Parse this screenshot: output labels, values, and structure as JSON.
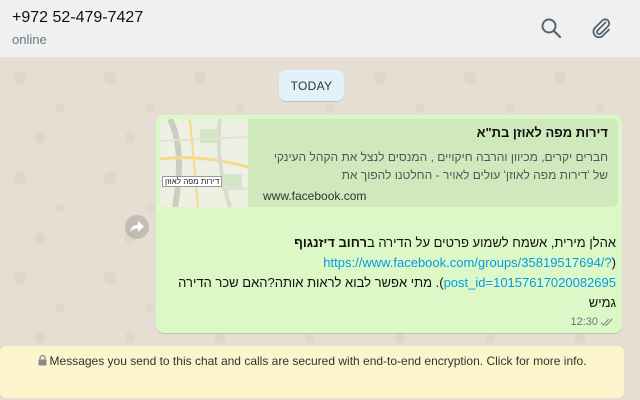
{
  "header": {
    "contact_name": "+972 52-479-7427",
    "status": "online",
    "icons": [
      "search-icon",
      "paperclip-icon"
    ]
  },
  "chat": {
    "day_label": "TODAY",
    "message": {
      "preview": {
        "title": "דירות מפה לאוזן בת\"א",
        "description": "חברים יקרים, מכיוון והרבה חיקויים , המנסים לנצל את הקהל העינקי של 'דירות מפה לאוזן' עולים לאויר - החלטנו להפוך את",
        "domain": "www.facebook.com",
        "thumbnail_label": "דירות מפה לאוזן"
      },
      "text_part1": "אהלן מירית, אשמח לשמוע פרטים על הדירה ב",
      "text_bold": "רחוב דיזנגוף",
      "text_part2": " (",
      "link": "https://www.facebook.com/groups/35819517694/?post_id=10157617020082695",
      "text_part3": "). מתי אפשר לבוא לראות אותה?האם שכר הדירה גמיש",
      "time": "12:30",
      "status": "read"
    },
    "forward_icon": "forward-icon"
  },
  "encryption_notice": {
    "text": "Messages you send to this chat and calls are secured with end-to-end encryption. Click for more info.",
    "icon": "lock-icon"
  },
  "colors": {
    "bubble_out": "#dcf8c6",
    "link": "#039be5",
    "notice_bg": "#fcf4cb",
    "day_pill_bg": "#e1f2fb"
  }
}
